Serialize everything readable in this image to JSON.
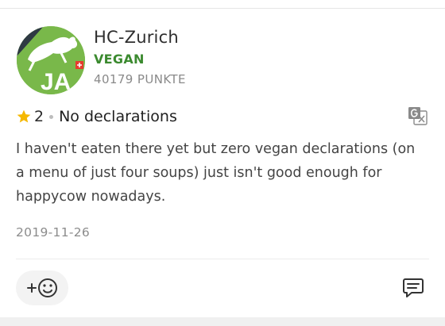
{
  "review": {
    "user_name": "HC-Zurich",
    "user_tag": "VEGAN",
    "user_points": "40179 PUNKTE",
    "rating": "2",
    "title": "No declarations",
    "text": "I haven't eaten there yet but zero vegan declarations (on a menu of just four soups) just isn't good enough for happycow nowadays.",
    "date": "2019-11-26"
  },
  "avatar": {
    "letters": "JA"
  },
  "icons": {
    "rating": "star-icon",
    "translate": "translate-icon",
    "react": "add-reaction-icon",
    "comment": "comment-icon"
  },
  "colors": {
    "vegan_tag": "#3b8a2f",
    "star": "#f5b800",
    "avatar_green": "#79b84a"
  }
}
